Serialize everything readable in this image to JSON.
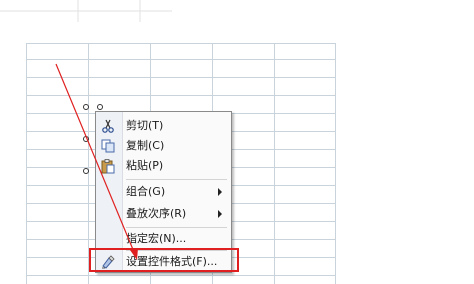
{
  "context_menu": {
    "items": [
      {
        "label": "剪切(T)",
        "icon": "scissors-icon"
      },
      {
        "label": "复制(C)",
        "icon": "copy-icon"
      },
      {
        "label": "粘贴(P)",
        "icon": "paste-icon"
      },
      {
        "label": "组合(G)",
        "submenu": true
      },
      {
        "label": "叠放次序(R)",
        "submenu": true
      },
      {
        "label": "指定宏(N)..."
      },
      {
        "label": "设置控件格式(F)...",
        "icon": "format-control-icon",
        "highlighted": true
      }
    ]
  },
  "colors": {
    "highlight": "#e02020",
    "arrow": "#e02020",
    "grid_line": "#c9d3dc"
  }
}
